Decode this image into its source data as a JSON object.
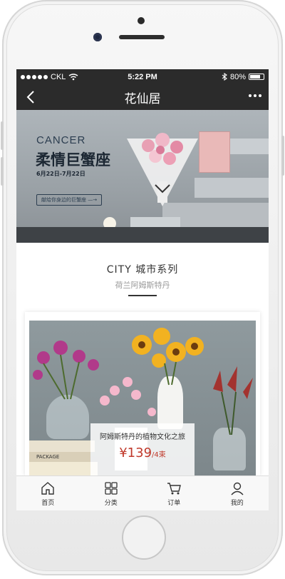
{
  "status": {
    "carrier": "CKL",
    "time": "5:22 PM",
    "battery": "80%",
    "battery_level": 0.8
  },
  "nav": {
    "title": "花仙居"
  },
  "banner": {
    "en": "CANCER",
    "cn": "柔情巨蟹座",
    "date": "6月22日-7月22日",
    "button": "献给你身边的巨蟹座 —→"
  },
  "section": {
    "title": "CITY  城市系列",
    "subtitle": "荷兰阿姆斯特丹"
  },
  "card": {
    "caption": "阿姆斯特丹的植物文化之旅",
    "price": "¥139",
    "unit": "/4束",
    "package_text": "PACKAGE"
  },
  "tabs": [
    {
      "label": "首页",
      "icon": "home-icon"
    },
    {
      "label": "分类",
      "icon": "category-icon"
    },
    {
      "label": "订单",
      "icon": "cart-icon"
    },
    {
      "label": "我的",
      "icon": "profile-icon"
    }
  ]
}
